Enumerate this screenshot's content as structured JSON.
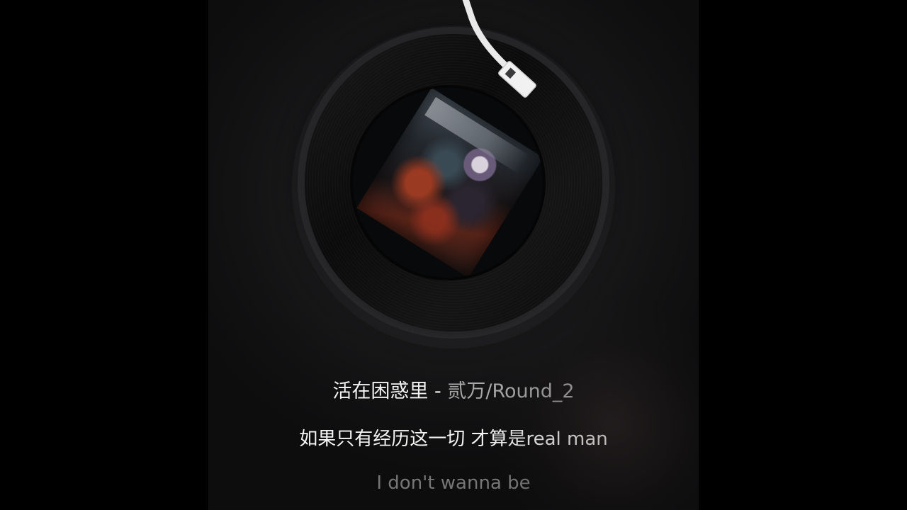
{
  "song": {
    "title": "活在困惑里",
    "separator": " - ",
    "artist": "贰万/Round_2"
  },
  "lyrics": {
    "current": "如果只有经历这一切 才算是real man",
    "next": "I don't wanna be"
  },
  "icons": {
    "tonearm": "tonearm-icon",
    "record": "vinyl-record"
  },
  "colors": {
    "background": "#000000",
    "panel": "#1c1c1e",
    "title": "#f2f2f2",
    "artist": "#a8a8a8",
    "lyric_current": "#f4f4f4",
    "lyric_next": "#9a9a9a"
  }
}
